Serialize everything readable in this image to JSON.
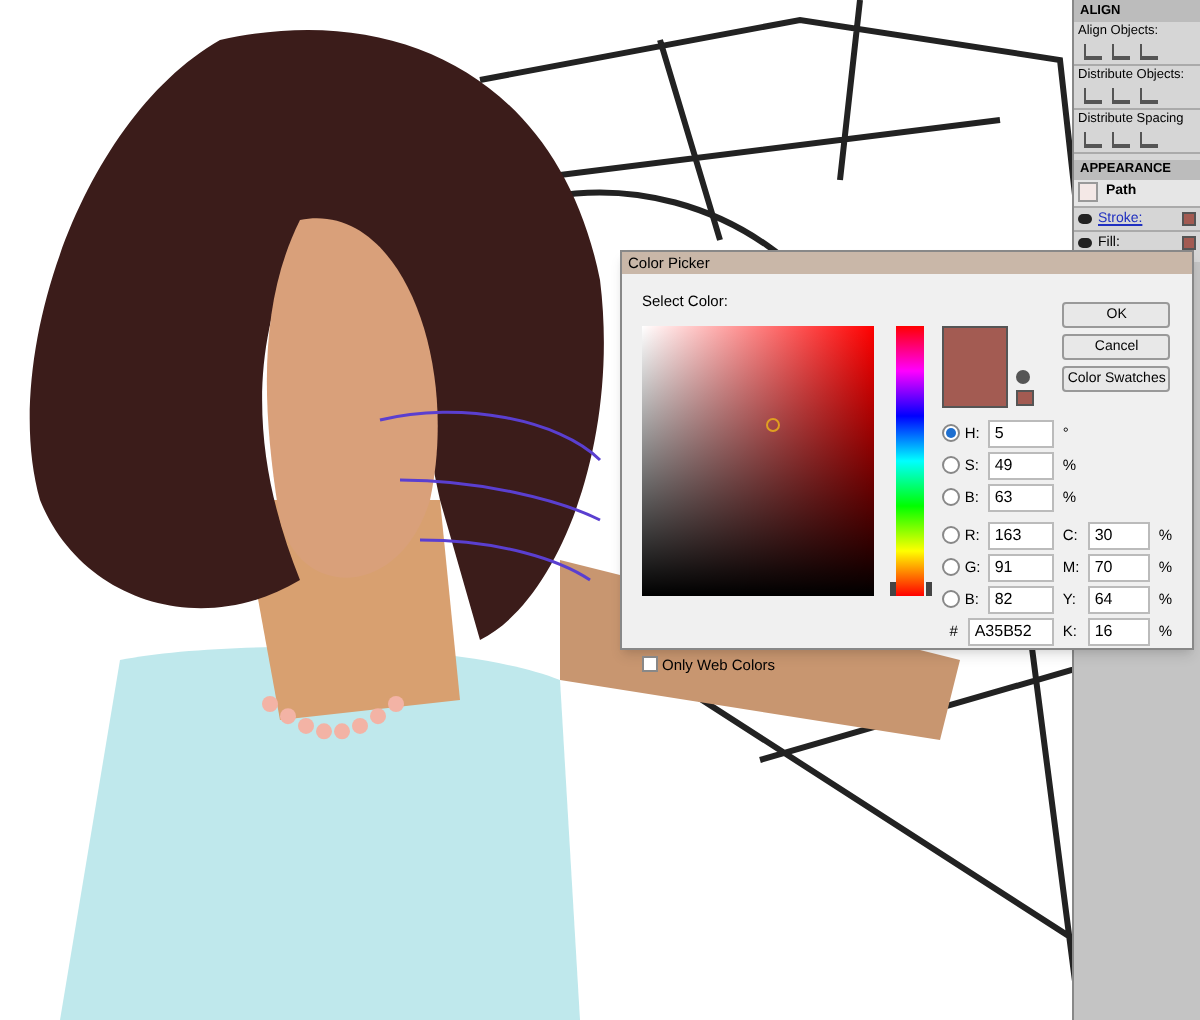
{
  "align_panel": {
    "title": "ALIGN",
    "sections": [
      "Align Objects:",
      "Distribute Objects:",
      "Distribute Spacing"
    ]
  },
  "appearance_panel": {
    "title": "APPEARANCE",
    "item": "Path",
    "attributes": [
      {
        "label": "Stroke:",
        "selected": true
      },
      {
        "label": "Fill:",
        "selected": false
      }
    ]
  },
  "color_picker": {
    "title": "Color Picker",
    "label": "Select Color:",
    "hue_slider": {
      "level": 0.01
    },
    "color": "#a35b52",
    "buttons": [
      "OK",
      "Cancel",
      "Color Swatches"
    ],
    "hsb_fields": [
      {
        "label": "H:",
        "value": "5",
        "unit": "°",
        "selected": true
      },
      {
        "label": "S:",
        "value": "49",
        "unit": "%",
        "selected": false
      },
      {
        "label": "B:",
        "value": "63",
        "unit": "%",
        "selected": false
      }
    ],
    "rgb_fields": [
      {
        "label": "R:",
        "value": "163",
        "selected": false
      },
      {
        "label": "G:",
        "value": "91",
        "selected": false
      },
      {
        "label": "B:",
        "value": "82",
        "selected": false
      }
    ],
    "hex_field": {
      "label": "#",
      "value": "A35B52"
    },
    "cmyk_fields": [
      {
        "label": "C:",
        "value": "30",
        "unit": "%"
      },
      {
        "label": "M:",
        "value": "70",
        "unit": "%"
      },
      {
        "label": "Y:",
        "value": "64",
        "unit": "%"
      },
      {
        "label": "K:",
        "value": "16",
        "unit": "%"
      }
    ],
    "web_colors": {
      "label": "Only Web Colors",
      "checked": false
    }
  }
}
